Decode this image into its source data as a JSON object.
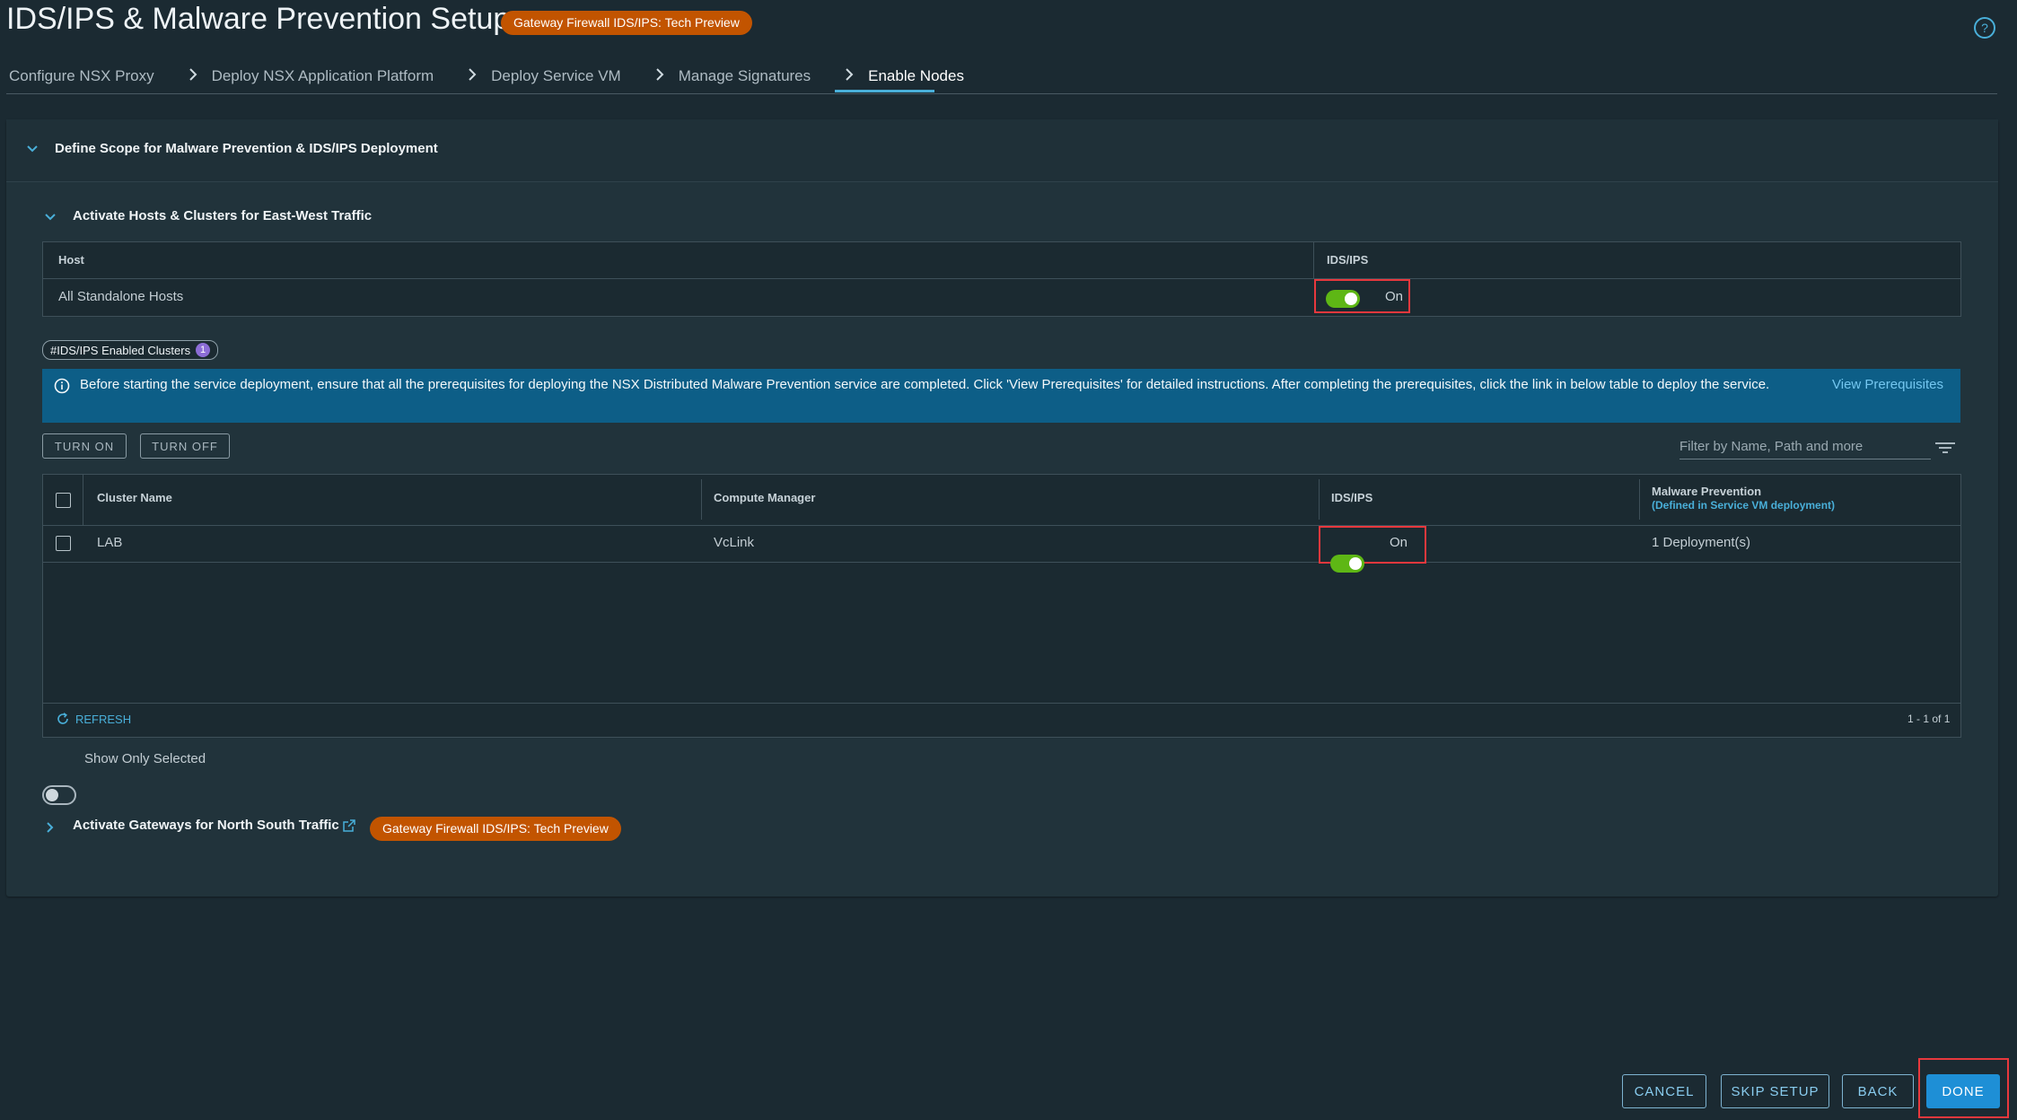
{
  "header": {
    "title": "IDS/IPS & Malware Prevention Setup",
    "badge": "Gateway Firewall IDS/IPS: Tech Preview",
    "help_icon": "help-circle-icon"
  },
  "wizard": {
    "steps": [
      {
        "label": "Configure NSX Proxy"
      },
      {
        "label": "Deploy NSX Application Platform"
      },
      {
        "label": "Deploy Service VM"
      },
      {
        "label": "Manage Signatures"
      },
      {
        "label": "Enable Nodes",
        "active": true
      }
    ]
  },
  "scope_section": {
    "title": "Define Scope for Malware Prevention & IDS/IPS Deployment"
  },
  "east_west": {
    "title": "Activate Hosts & Clusters for East-West Traffic",
    "host_table": {
      "columns": [
        "Host",
        "IDS/IPS"
      ],
      "rows": [
        {
          "host": "All Standalone Hosts",
          "ids_ips": "On"
        }
      ]
    },
    "clusters_tag": {
      "label": "#IDS/IPS Enabled Clusters",
      "count": "1"
    },
    "alert": {
      "text": "Before starting the service deployment, ensure that all the prerequisites for deploying the NSX Distributed Malware Prevention service are completed. Click 'View Prerequisites' for detailed instructions. After completing the prerequisites, click the link in below table to deploy the service.",
      "link": "View Prerequisites"
    },
    "actions": {
      "turn_on": "TURN ON",
      "turn_off": "TURN OFF"
    },
    "filter": {
      "placeholder": "Filter by Name, Path and more"
    },
    "cluster_table": {
      "columns": {
        "cluster_name": "Cluster Name",
        "compute_manager": "Compute Manager",
        "ids_ips": "IDS/IPS",
        "malware": "Malware Prevention",
        "malware_sub": "(Defined in Service VM deployment)"
      },
      "rows": [
        {
          "cluster_name": "LAB",
          "compute_manager": "VcLink",
          "ids_ips": "On",
          "malware": "1 Deployment(s)"
        }
      ],
      "refresh": "REFRESH",
      "pagination": "1 - 1 of 1"
    },
    "show_only_selected": "Show Only Selected"
  },
  "north_south": {
    "title": "Activate Gateways for North South Traffic",
    "badge": "Gateway Firewall IDS/IPS: Tech Preview"
  },
  "footer": {
    "cancel": "CANCEL",
    "skip_setup": "SKIP SETUP",
    "back": "BACK",
    "done": "DONE"
  },
  "colors": {
    "background": "#1b2a32",
    "card": "#21333b",
    "accent": "#49afd9",
    "toggle_on": "#5eb715",
    "badge": "#c25400",
    "alert": "#0d5e87",
    "highlight_box": "#e8383d"
  }
}
